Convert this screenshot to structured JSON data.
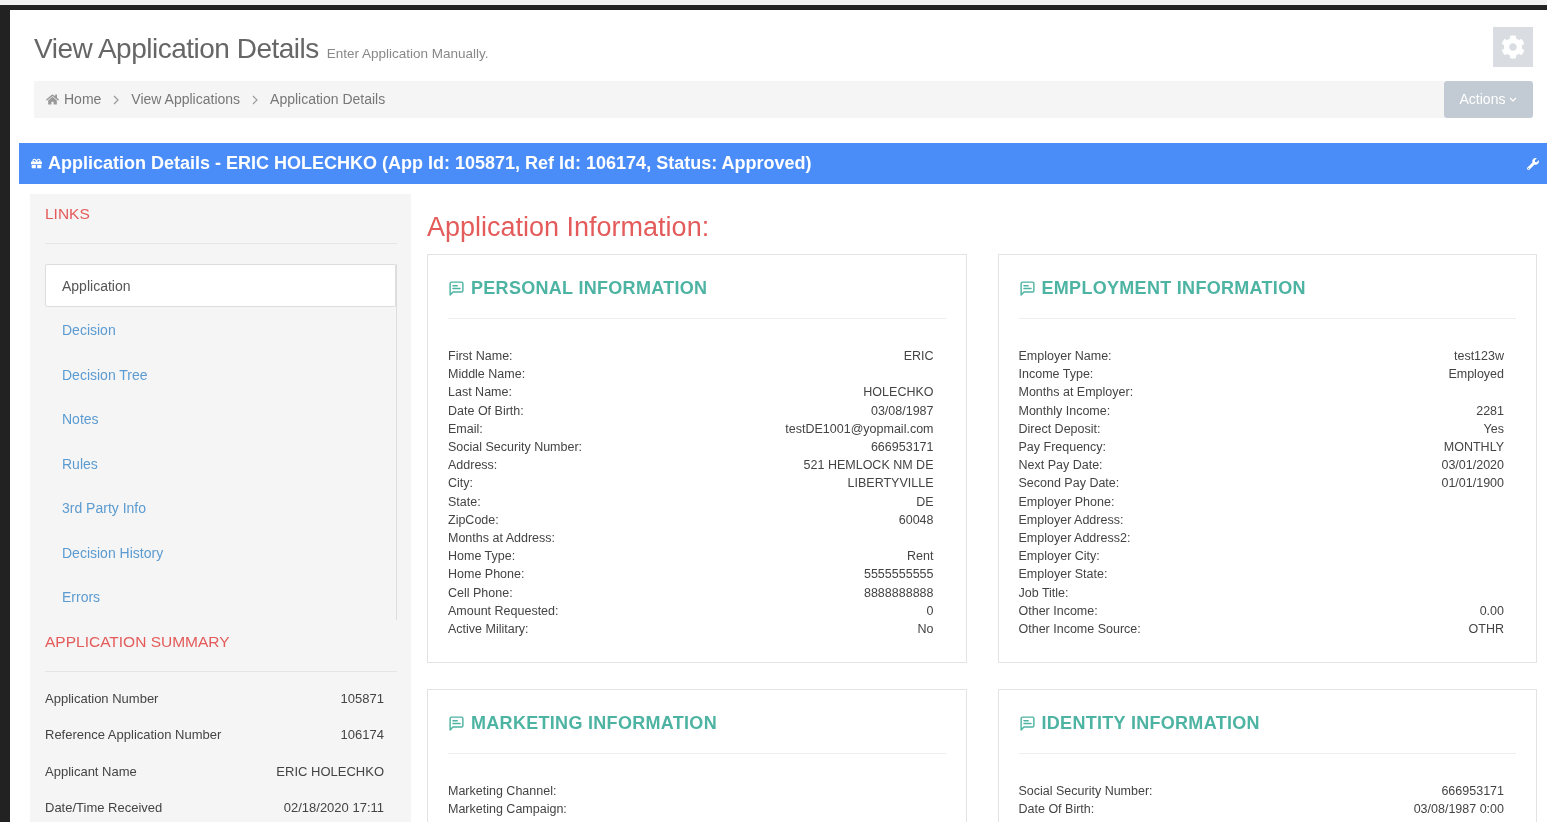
{
  "page_header": {
    "title": "View Application Details",
    "subtitle": "Enter Application Manually."
  },
  "breadcrumb": [
    {
      "label": "Home",
      "kind": "home"
    },
    {
      "label": "View Applications",
      "kind": "link"
    },
    {
      "label": "Application Details",
      "kind": "link"
    }
  ],
  "actions_button": "Actions",
  "panel_title": "Application Details - ERIC HOLECHKO (App Id: 105871, Ref Id: 106174, Status: Approved)",
  "sidebar": {
    "links_heading": "LINKS",
    "links": [
      {
        "label": "Application",
        "selected": true
      },
      {
        "label": "Decision",
        "selected": false
      },
      {
        "label": "Decision Tree",
        "selected": false
      },
      {
        "label": "Notes",
        "selected": false
      },
      {
        "label": "Rules",
        "selected": false
      },
      {
        "label": "3rd Party Info",
        "selected": false
      },
      {
        "label": "Decision History",
        "selected": false
      },
      {
        "label": "Errors",
        "selected": false
      }
    ],
    "summary_heading": "APPLICATION SUMMARY",
    "summary": [
      {
        "label": "Application Number",
        "value": "105871"
      },
      {
        "label": "Reference Application Number",
        "value": "106174"
      },
      {
        "label": "Applicant Name",
        "value": "ERIC HOLECHKO"
      },
      {
        "label": "Date/Time Received",
        "value": "02/18/2020 17:11"
      }
    ]
  },
  "main_heading": "Application Information:",
  "sections": [
    {
      "title": "PERSONAL INFORMATION",
      "fields": [
        {
          "label": "First Name:",
          "value": "ERIC"
        },
        {
          "label": "Middle Name:"
        },
        {
          "label": "Last Name:",
          "value": "HOLECHKO"
        },
        {
          "label": "Date Of Birth:",
          "value": "03/08/1987"
        },
        {
          "label": "Email:",
          "value": "testDE1001@yopmail.com"
        },
        {
          "label": "Social Security Number:",
          "value": "666953171"
        },
        {
          "label": "Address:",
          "value": "521 HEMLOCK NM DE"
        },
        {
          "label": "City:",
          "value": "LIBERTYVILLE"
        },
        {
          "label": "State:",
          "value": "DE"
        },
        {
          "label": "ZipCode:",
          "value": "60048"
        },
        {
          "label": "Months at Address:"
        },
        {
          "label": "Home Type:",
          "value": "Rent"
        },
        {
          "label": "Home Phone:",
          "value": "5555555555"
        },
        {
          "label": "Cell Phone:",
          "value": "8888888888"
        },
        {
          "label": "Amount Requested:",
          "value": "0"
        },
        {
          "label": "Active Military:",
          "value": "No"
        }
      ]
    },
    {
      "title": "EMPLOYMENT INFORMATION",
      "fields": [
        {
          "label": "Employer Name:",
          "value": "test123w"
        },
        {
          "label": "Income Type:",
          "value": "Employed"
        },
        {
          "label": "Months at Employer:"
        },
        {
          "label": "Monthly Income:",
          "value": "2281"
        },
        {
          "label": "Direct Deposit:",
          "value": "Yes"
        },
        {
          "label": "Pay Frequency:",
          "value": "MONTHLY"
        },
        {
          "label": "Next Pay Date:",
          "value": "03/01/2020"
        },
        {
          "label": "Second Pay Date:",
          "value": "01/01/1900"
        },
        {
          "label": "Employer Phone:"
        },
        {
          "label": "Employer Address:"
        },
        {
          "label": "Employer Address2:"
        },
        {
          "label": "Employer City:"
        },
        {
          "label": "Employer State:"
        },
        {
          "label": "Job Title:"
        },
        {
          "label": "Other Income:",
          "value": "0.00"
        },
        {
          "label": "Other Income Source:",
          "value": "OTHR"
        }
      ]
    },
    {
      "title": "MARKETING INFORMATION",
      "fields": [
        {
          "label": "Marketing Channel:"
        },
        {
          "label": "Marketing Campaign:"
        }
      ]
    },
    {
      "title": "IDENTITY INFORMATION",
      "fields": [
        {
          "label": "Social Security Number:",
          "value": "666953171"
        },
        {
          "label": "Date Of Birth:",
          "value": "03/08/1987 0:00"
        }
      ]
    }
  ]
}
